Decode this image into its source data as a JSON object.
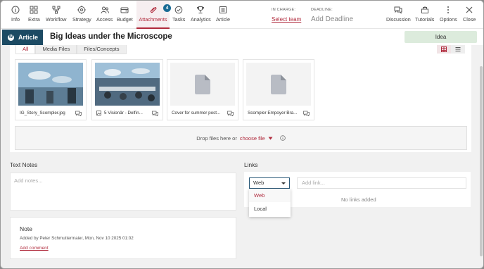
{
  "toolbar": {
    "items": [
      {
        "label": "Info",
        "icon": "info-icon"
      },
      {
        "label": "Extra",
        "icon": "grid-icon"
      },
      {
        "label": "Workflow",
        "icon": "workflow-icon"
      },
      {
        "label": "Strategy",
        "icon": "target-icon"
      },
      {
        "label": "Access",
        "icon": "users-icon"
      },
      {
        "label": "Budget",
        "icon": "budget-icon"
      },
      {
        "label": "Attachments",
        "icon": "paperclip-icon"
      },
      {
        "label": "Tasks",
        "icon": "check-circle-icon"
      },
      {
        "label": "Analytics",
        "icon": "trophy-icon"
      },
      {
        "label": "Article",
        "icon": "article-icon"
      }
    ],
    "attachments_badge": "4",
    "in_charge_label": "IN CHARGE:",
    "in_charge_value": "Select team",
    "deadline_label": "DEADLINE:",
    "deadline_value": "Add Deadline",
    "right_items": [
      {
        "label": "Discussion",
        "icon": "chat-icon"
      },
      {
        "label": "Tutorials",
        "icon": "tutorials-icon"
      },
      {
        "label": "Options",
        "icon": "more-vertical-icon"
      },
      {
        "label": "Close",
        "icon": "close-icon"
      }
    ],
    "accent_color": "#b02a3c"
  },
  "header": {
    "type_tag": "Article",
    "wp_glyph": "W",
    "title": "Big Ideas under the Microscope",
    "status": "Idea"
  },
  "attachments": {
    "tabs": [
      "All",
      "Media Files",
      "Files/Concepts"
    ],
    "active_tab": "All",
    "files": [
      {
        "name": "IG_Story_Scompler.jpg",
        "kind": "image"
      },
      {
        "name": "5 Visionär - Delfin...",
        "kind": "image"
      },
      {
        "name": "Cover for summer post...",
        "kind": "document"
      },
      {
        "name": "Scompler Empoyer Bra...",
        "kind": "document"
      }
    ],
    "dropzone_text": "Drop files here or",
    "dropzone_link": "choose file"
  },
  "text_notes": {
    "label": "Text Notes",
    "placeholder": "Add notes..."
  },
  "links": {
    "label": "Links",
    "type_value": "Web",
    "input_placeholder": "Add link...",
    "empty_text": "No links added",
    "options": [
      "Web",
      "Local"
    ]
  },
  "note": {
    "title": "Note",
    "meta": "Added by Peter Schmuttermaier, Mon, Nov 10 2025 01:02",
    "add_comment": "Add comment"
  }
}
